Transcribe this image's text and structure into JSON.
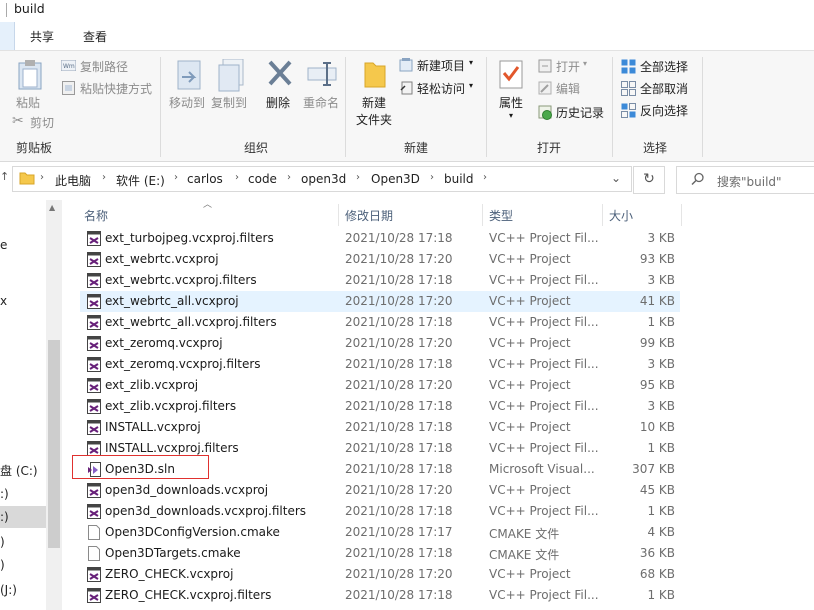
{
  "window": {
    "title": "build"
  },
  "tabs": [
    {
      "label": "共享"
    },
    {
      "label": "查看"
    }
  ],
  "ribbon": {
    "clipboard": {
      "paste": "粘贴",
      "copy_path": "复制路径",
      "paste_shortcut": "粘贴快捷方式",
      "cut": "剪切",
      "group": "剪贴板"
    },
    "organize": {
      "move_to": "移动到",
      "copy_to": "复制到",
      "delete": "删除",
      "rename": "重命名",
      "group": "组织"
    },
    "new": {
      "new_folder_line1": "新建",
      "new_folder_line2": "文件夹",
      "new_item": "新建项目",
      "easy_access": "轻松访问",
      "group": "新建"
    },
    "open": {
      "properties": "属性",
      "open": "打开",
      "edit": "编辑",
      "history": "历史记录",
      "group": "打开"
    },
    "select": {
      "select_all": "全部选择",
      "select_none": "全部取消",
      "invert": "反向选择",
      "group": "选择"
    }
  },
  "address": {
    "crumbs": [
      "此电脑",
      "软件 (E:)",
      "carlos",
      "code",
      "open3d",
      "Open3D",
      "build"
    ]
  },
  "search": {
    "placeholder": "搜索\"build\""
  },
  "nav": {
    "items": [
      {
        "label": "e"
      },
      {
        "label": "х"
      },
      {
        "label": "盘 (C:)"
      },
      {
        "label": ":)"
      },
      {
        "label": ":)"
      },
      {
        "label": ")"
      },
      {
        "label": ")"
      },
      {
        "label": "(J:)"
      }
    ]
  },
  "columns": {
    "name": "名称",
    "date": "修改日期",
    "type": "类型",
    "size": "大小"
  },
  "files": [
    {
      "name": "ext_turbojpeg.vcxproj.filters",
      "date": "2021/10/28 17:18",
      "type": "VC++ Project Fil...",
      "size": "3 KB",
      "icon": "filters"
    },
    {
      "name": "ext_webrtc.vcxproj",
      "date": "2021/10/28 17:20",
      "type": "VC++ Project",
      "size": "93 KB",
      "icon": "vcxproj"
    },
    {
      "name": "ext_webrtc.vcxproj.filters",
      "date": "2021/10/28 17:18",
      "type": "VC++ Project Fil...",
      "size": "3 KB",
      "icon": "filters"
    },
    {
      "name": "ext_webrtc_all.vcxproj",
      "date": "2021/10/28 17:20",
      "type": "VC++ Project",
      "size": "41 KB",
      "icon": "vcxproj"
    },
    {
      "name": "ext_webrtc_all.vcxproj.filters",
      "date": "2021/10/28 17:18",
      "type": "VC++ Project Fil...",
      "size": "1 KB",
      "icon": "filters"
    },
    {
      "name": "ext_zeromq.vcxproj",
      "date": "2021/10/28 17:20",
      "type": "VC++ Project",
      "size": "99 KB",
      "icon": "vcxproj"
    },
    {
      "name": "ext_zeromq.vcxproj.filters",
      "date": "2021/10/28 17:18",
      "type": "VC++ Project Fil...",
      "size": "3 KB",
      "icon": "filters"
    },
    {
      "name": "ext_zlib.vcxproj",
      "date": "2021/10/28 17:20",
      "type": "VC++ Project",
      "size": "95 KB",
      "icon": "vcxproj"
    },
    {
      "name": "ext_zlib.vcxproj.filters",
      "date": "2021/10/28 17:18",
      "type": "VC++ Project Fil...",
      "size": "3 KB",
      "icon": "filters"
    },
    {
      "name": "INSTALL.vcxproj",
      "date": "2021/10/28 17:18",
      "type": "VC++ Project",
      "size": "10 KB",
      "icon": "vcxproj"
    },
    {
      "name": "INSTALL.vcxproj.filters",
      "date": "2021/10/28 17:18",
      "type": "VC++ Project Fil...",
      "size": "1 KB",
      "icon": "filters"
    },
    {
      "name": "Open3D.sln",
      "date": "2021/10/28 17:18",
      "type": "Microsoft Visual...",
      "size": "307 KB",
      "icon": "sln"
    },
    {
      "name": "open3d_downloads.vcxproj",
      "date": "2021/10/28 17:20",
      "type": "VC++ Project",
      "size": "45 KB",
      "icon": "vcxproj"
    },
    {
      "name": "open3d_downloads.vcxproj.filters",
      "date": "2021/10/28 17:18",
      "type": "VC++ Project Fil...",
      "size": "1 KB",
      "icon": "filters"
    },
    {
      "name": "Open3DConfigVersion.cmake",
      "date": "2021/10/28 17:17",
      "type": "CMAKE 文件",
      "size": "4 KB",
      "icon": "cmake"
    },
    {
      "name": "Open3DTargets.cmake",
      "date": "2021/10/28 17:18",
      "type": "CMAKE 文件",
      "size": "36 KB",
      "icon": "cmake"
    },
    {
      "name": "ZERO_CHECK.vcxproj",
      "date": "2021/10/28 17:20",
      "type": "VC++ Project",
      "size": "68 KB",
      "icon": "vcxproj"
    },
    {
      "name": "ZERO_CHECK.vcxproj.filters",
      "date": "2021/10/28 17:18",
      "type": "VC++ Project Fil...",
      "size": "1 KB",
      "icon": "filters"
    }
  ],
  "selected_row": 3,
  "highlighted_row": 11,
  "colors": {
    "accent": "#0078d7",
    "selection": "#e5f3ff",
    "highlight_border": "#e0312f"
  }
}
